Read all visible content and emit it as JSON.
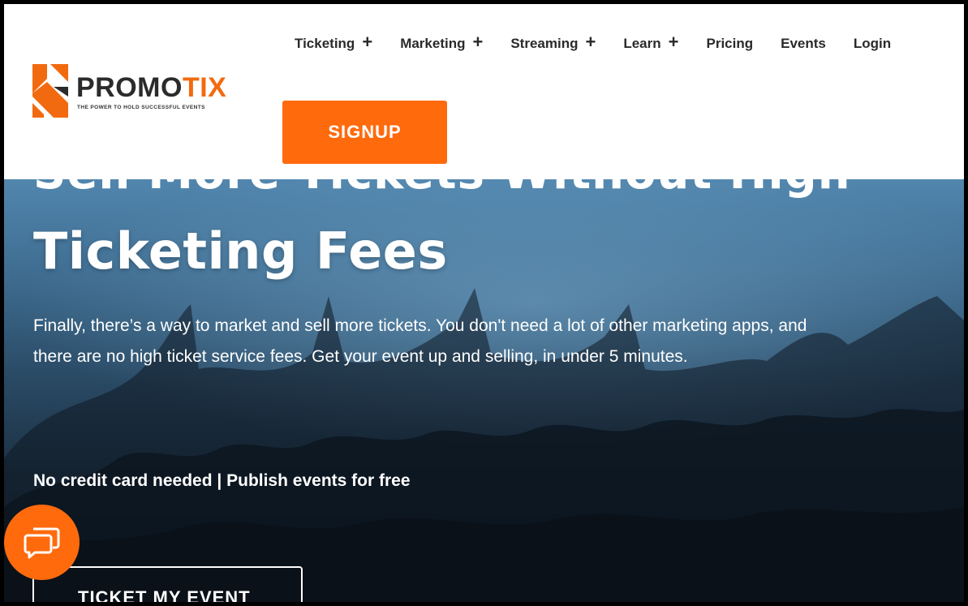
{
  "header": {
    "logo": {
      "name_primary": "PROMO",
      "name_accent": "TIX",
      "tagline": "THE POWER TO HOLD SUCCESSFUL EVENTS"
    },
    "nav": [
      {
        "label": "Ticketing",
        "expand": "+"
      },
      {
        "label": "Marketing",
        "expand": "+"
      },
      {
        "label": "Streaming",
        "expand": "+"
      },
      {
        "label": "Learn",
        "expand": "+"
      },
      {
        "label": "Pricing"
      },
      {
        "label": "Events"
      },
      {
        "label": "Login"
      }
    ],
    "signup_label": "SIGNUP"
  },
  "hero": {
    "title_line1": "Sell More Tickets Without High",
    "title_line2": "Ticketing Fees",
    "description": "Finally, there’s a way to market and sell more tickets. You don't need a lot of other marketing apps, and there are no high ticket service fees. Get your event up and selling, in under 5 minutes.",
    "note": "No credit card needed | Publish events for free",
    "cta_label": "TICKET MY EVENT"
  },
  "colors": {
    "accent": "#ff6a0d",
    "hero_top": "#5e95bd",
    "hero_bottom": "#121e2a"
  },
  "icons": {
    "chat": "chat-bubbles-icon",
    "logo": "promotix-logo-icon"
  }
}
